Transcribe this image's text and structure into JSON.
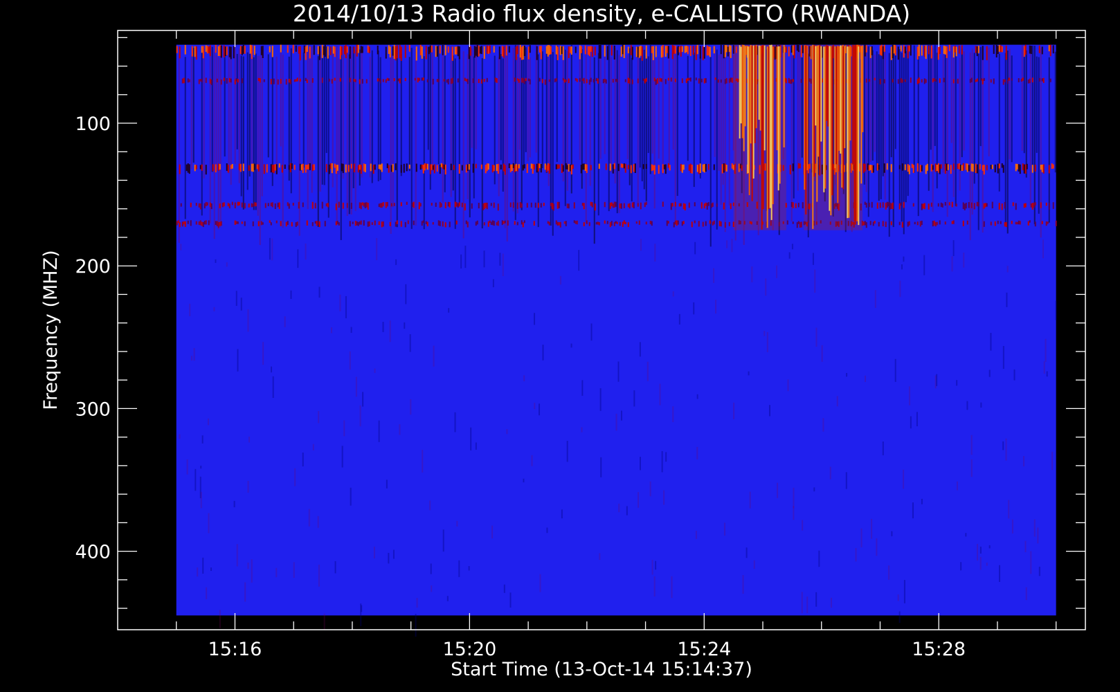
{
  "chart_data": {
    "type": "heatmap",
    "title": "2014/10/13  Radio flux density, e-CALLISTO (RWANDA)",
    "xlabel": "Start Time (13-Oct-14 15:14:37)",
    "ylabel": "Frequency (MHZ)",
    "x_ticks": [
      {
        "label": "15:16",
        "minutes": 16
      },
      {
        "label": "15:20",
        "minutes": 20
      },
      {
        "label": "15:24",
        "minutes": 24
      },
      {
        "label": "15:28",
        "minutes": 28
      }
    ],
    "y_ticks": [
      {
        "label": "100",
        "value": 100
      },
      {
        "label": "200",
        "value": 200
      },
      {
        "label": "300",
        "value": 300
      },
      {
        "label": "400",
        "value": 400
      }
    ],
    "xlim_minutes": [
      14.0,
      30.5
    ],
    "ylim_mhz": [
      455,
      35
    ],
    "data_extent": {
      "time_minutes": [
        15.0,
        30.0
      ],
      "freq_mhz": [
        45,
        445
      ]
    },
    "colormap": [
      "#000000",
      "#2222ff",
      "#c40000",
      "#ff6a00",
      "#ffff80"
    ],
    "background_level_color": "#2020ee",
    "features": [
      {
        "name": "upper band",
        "freq_mhz": [
          45,
          55
        ],
        "time_minutes": [
          15.0,
          30.0
        ],
        "level": "high"
      },
      {
        "name": "band 2",
        "freq_mhz": [
          68,
          72
        ],
        "time_minutes": [
          15.0,
          30.0
        ],
        "level": "moderate"
      },
      {
        "name": "band 3",
        "freq_mhz": [
          128,
          135
        ],
        "time_minutes": [
          15.0,
          30.0
        ],
        "level": "high"
      },
      {
        "name": "band 4",
        "freq_mhz": [
          155,
          160
        ],
        "time_minutes": [
          15.0,
          30.0
        ],
        "level": "moderate"
      },
      {
        "name": "band 5",
        "freq_mhz": [
          168,
          172
        ],
        "time_minutes": [
          15.0,
          30.0
        ],
        "level": "moderate"
      },
      {
        "name": "burst 1",
        "freq_mhz": [
          45,
          175
        ],
        "time_minutes": [
          24.5,
          25.4
        ],
        "level": "intense"
      },
      {
        "name": "burst 2",
        "freq_mhz": [
          45,
          175
        ],
        "time_minutes": [
          25.7,
          26.7
        ],
        "level": "intense"
      }
    ]
  }
}
